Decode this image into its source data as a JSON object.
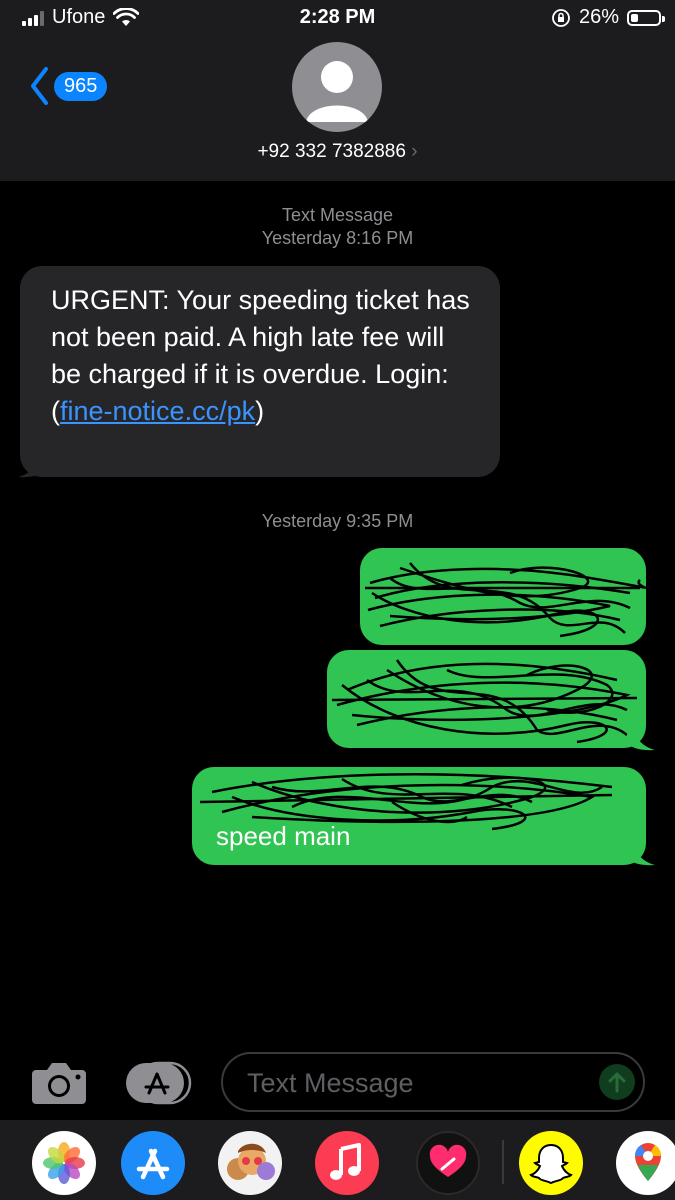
{
  "status_bar": {
    "carrier": "Ufone",
    "time": "2:28 PM",
    "battery": "26%",
    "battery_level": 0.26
  },
  "header": {
    "back_count": "965",
    "contact": "+92 332 7382886"
  },
  "thread": {
    "service_label": "Text Message",
    "timestamp_1": "Yesterday 8:16 PM",
    "incoming": {
      "text_before_link": "URGENT: Your speeding ticket has not been paid. A high late fee will be charged if it is overdue. Login: (",
      "link": "fine-notice.cc/pk",
      "text_after_link": ")"
    },
    "timestamp_2": "Yesterday 9:35 PM",
    "outgoing_visible_text": "speed main"
  },
  "compose": {
    "placeholder": "Text Message"
  },
  "dock": {
    "apps": [
      "Photos",
      "App Store",
      "Memoji",
      "Music",
      "Fitness",
      "Snapchat",
      "Google Maps"
    ]
  },
  "colors": {
    "outgoing_bubble": "#30c552",
    "incoming_bubble": "#262629",
    "link": "#3a94ff",
    "accent": "#0a84ff"
  }
}
